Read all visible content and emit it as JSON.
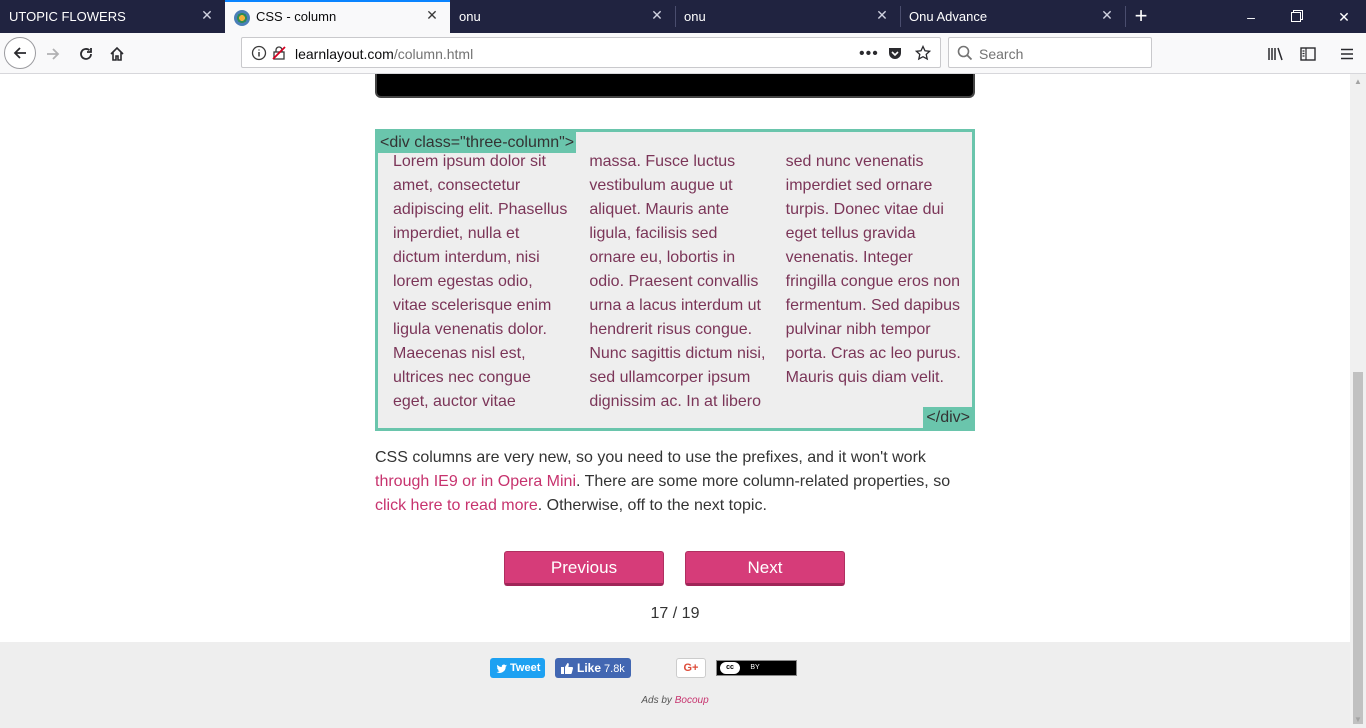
{
  "browser": {
    "tabs": [
      {
        "title": "UTOPIC FLOWERS",
        "active": false
      },
      {
        "title": "CSS - column",
        "active": true
      },
      {
        "title": "onu",
        "active": false
      },
      {
        "title": "onu",
        "active": false
      },
      {
        "title": "Onu Advance",
        "active": false
      }
    ],
    "url": {
      "domain": "learnlayout.com",
      "path": "/column.html"
    },
    "search_placeholder": "Search"
  },
  "demo": {
    "open_tag": "<div class=\"three-column\">",
    "close_tag": "</div>",
    "text": "Lorem ipsum dolor sit amet, consectetur adipiscing elit. Phasellus imperdiet, nulla et dictum interdum, nisi lorem egestas odio, vitae scelerisque enim ligula venenatis dolor. Maecenas nisl est, ultrices nec congue eget, auctor vitae massa. Fusce luctus vestibulum augue ut aliquet. Mauris ante ligula, facilisis sed ornare eu, lobortis in odio. Praesent convallis urna a lacus interdum ut hendrerit risus congue. Nunc sagittis dictum nisi, sed ullamcorper ipsum dignissim ac. In at libero sed nunc venenatis imperdiet sed ornare turpis. Donec vitae dui eget tellus gravida venenatis. Integer fringilla congue eros non fermentum. Sed dapibus pulvinar nibh tempor porta. Cras ac leo purus. Mauris quis diam velit."
  },
  "prose": {
    "part1": "CSS columns are very new, so you need to use the prefixes, and it won't work ",
    "link1": "through IE9 or in Opera Mini",
    "part2": ". There are some more column-related properties, so ",
    "link2": "click here to read more",
    "part3": ". Otherwise, off to the next topic."
  },
  "pager": {
    "previous": "Previous",
    "next": "Next",
    "count": "17 / 19"
  },
  "footer": {
    "tweet": "Tweet",
    "like": "Like",
    "like_count": "7.8k",
    "gplus": "G+",
    "cc": "BY",
    "ads_prefix": "Ads by ",
    "ads_link": "Bocoup"
  }
}
